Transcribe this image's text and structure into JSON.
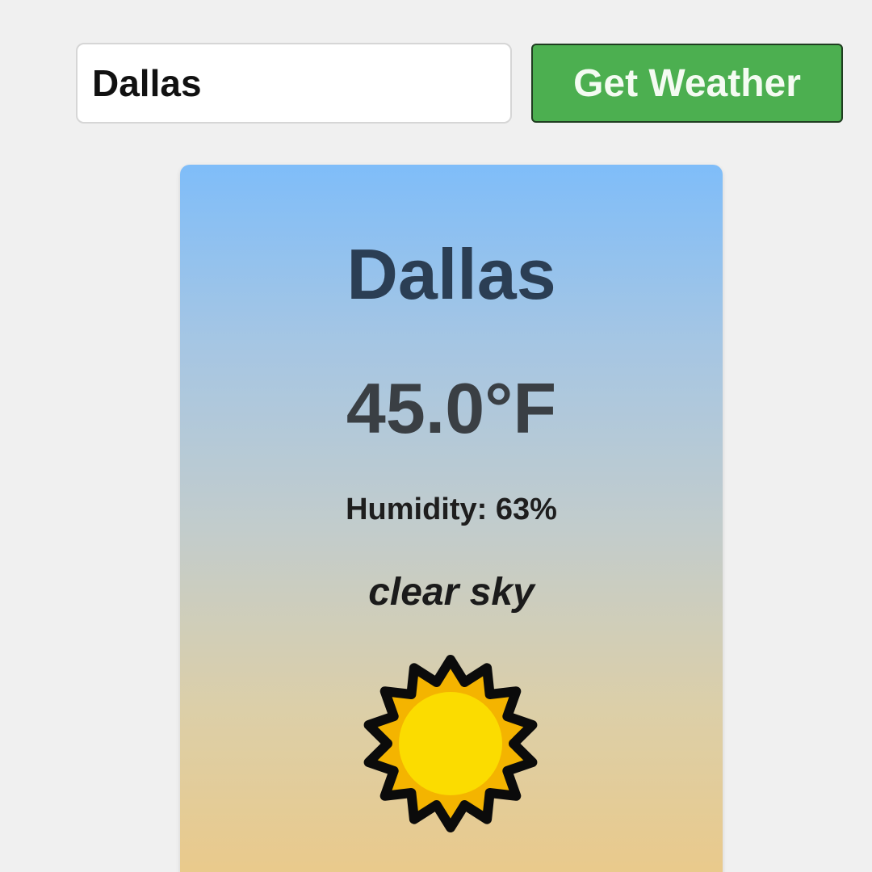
{
  "search": {
    "city_value": "Dallas",
    "button_label": "Get Weather"
  },
  "weather": {
    "city": "Dallas",
    "temperature": "45.0°F",
    "humidity": "Humidity: 63%",
    "description": "clear sky",
    "icon": "sun-icon"
  },
  "colors": {
    "button": "#4caf50",
    "card_top": "#7fbdf9",
    "card_bottom": "#ebc988",
    "sun_outer": "#f4b400",
    "sun_inner": "#fbdc00"
  }
}
